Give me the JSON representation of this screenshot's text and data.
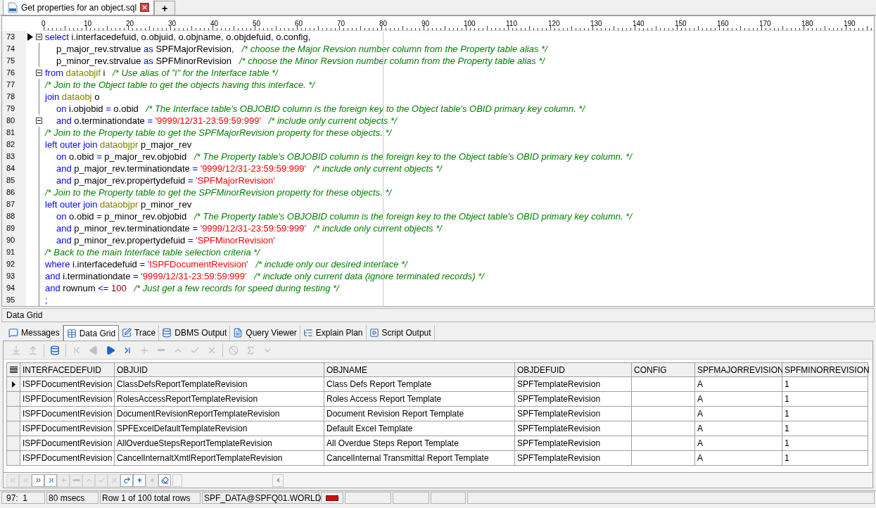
{
  "document_tabs": [
    {
      "label": "Get properties for an object.sql",
      "selected": true
    }
  ],
  "new_tab_button": "+",
  "editor": {
    "ruler": [
      "0",
      "10",
      "20",
      "30",
      "40",
      "50",
      "60",
      "70",
      "80",
      "90",
      "100",
      "110",
      "120",
      "130",
      "140",
      "150",
      "160",
      "170",
      "180",
      "190"
    ],
    "lines": [
      {
        "number": "73",
        "current": true,
        "fold": true,
        "indented": false,
        "tokens": [
          {
            "kind": "kw",
            "text": "select"
          },
          {
            "kind": "txt",
            "text": " i.interfacedefuid"
          },
          {
            "kind": "kw",
            "text": ","
          },
          {
            "kind": "txt",
            "text": " o.objuid"
          },
          {
            "kind": "kw",
            "text": ","
          },
          {
            "kind": "txt",
            "text": " o.objname"
          },
          {
            "kind": "kw",
            "text": ","
          },
          {
            "kind": "txt",
            "text": " o.objdefuid"
          },
          {
            "kind": "kw",
            "text": ","
          },
          {
            "kind": "txt",
            "text": " o.config"
          },
          {
            "kind": "kw",
            "text": ","
          }
        ]
      },
      {
        "number": "74",
        "current": false,
        "fold": false,
        "indented": true,
        "tokens": [
          {
            "kind": "txt",
            "text": "p_major_rev.strvalue "
          },
          {
            "kind": "kw",
            "text": "as"
          },
          {
            "kind": "txt",
            "text": " SPFMajorRevision"
          },
          {
            "kind": "kw",
            "text": ","
          },
          {
            "kind": "cmt",
            "text": "   /* choose the Major Revsion number column from the Property table alias */"
          }
        ]
      },
      {
        "number": "75",
        "current": false,
        "fold": false,
        "indented": true,
        "tokens": [
          {
            "kind": "txt",
            "text": "p_minor_rev.strvalue "
          },
          {
            "kind": "kw",
            "text": "as"
          },
          {
            "kind": "txt",
            "text": " SPFMinorRevision   "
          },
          {
            "kind": "cmt",
            "text": "/* choose the Minor Revsion number column from the Property table alias */"
          }
        ]
      },
      {
        "number": "76",
        "current": false,
        "fold": true,
        "indented": false,
        "tokens": [
          {
            "kind": "kw",
            "text": "from"
          },
          {
            "kind": "tbl",
            "text": " dataobjif"
          },
          {
            "kind": "txt",
            "text": " i   "
          },
          {
            "kind": "cmt",
            "text": "/* Use alias of \"i\" for the Interface table */"
          }
        ]
      },
      {
        "number": "77",
        "current": false,
        "fold": false,
        "indented": false,
        "tokens": [
          {
            "kind": "cmt",
            "text": "/* Join to the Object table to get the objects having this interface. */"
          }
        ]
      },
      {
        "number": "78",
        "current": false,
        "fold": false,
        "indented": false,
        "tokens": [
          {
            "kind": "kw",
            "text": "join"
          },
          {
            "kind": "tbl",
            "text": " dataobj"
          },
          {
            "kind": "txt",
            "text": " o"
          }
        ]
      },
      {
        "number": "79",
        "current": false,
        "fold": false,
        "indented": true,
        "tokens": [
          {
            "kind": "kw",
            "text": "on"
          },
          {
            "kind": "txt",
            "text": " i.objobid "
          },
          {
            "kind": "kw",
            "text": "="
          },
          {
            "kind": "txt",
            "text": " o.obid   "
          },
          {
            "kind": "cmt",
            "text": "/* The Interface table's OBJOBID column is the foreign key to the Object table's OBID primary key column. */"
          }
        ]
      },
      {
        "number": "80",
        "current": false,
        "fold": true,
        "indented": true,
        "tokens": [
          {
            "kind": "kw",
            "text": "and"
          },
          {
            "kind": "txt",
            "text": " o.terminationdate "
          },
          {
            "kind": "kw",
            "text": "="
          },
          {
            "kind": "str",
            "text": " '9999/12/31-23:59:59:999'"
          },
          {
            "kind": "cmt",
            "text": "   /* include only current objects */"
          }
        ]
      },
      {
        "number": "81",
        "current": false,
        "fold": false,
        "indented": false,
        "tokens": [
          {
            "kind": "cmt",
            "text": "/* Join to the Property table to get the SPFMajorRevision property for these objects. */"
          }
        ]
      },
      {
        "number": "82",
        "current": false,
        "fold": false,
        "indented": false,
        "tokens": [
          {
            "kind": "kw",
            "text": "left outer join"
          },
          {
            "kind": "tbl",
            "text": " dataobjpr"
          },
          {
            "kind": "txt",
            "text": " p_major_rev"
          }
        ]
      },
      {
        "number": "83",
        "current": false,
        "fold": false,
        "indented": true,
        "tokens": [
          {
            "kind": "kw",
            "text": "on"
          },
          {
            "kind": "txt",
            "text": " o.obid "
          },
          {
            "kind": "kw",
            "text": "="
          },
          {
            "kind": "txt",
            "text": " p_major_rev.objobid   "
          },
          {
            "kind": "cmt",
            "text": "/* The Property table's OBJOBID column is the foreign key to the Object table's OBID primary key column. */"
          }
        ]
      },
      {
        "number": "84",
        "current": false,
        "fold": false,
        "indented": true,
        "tokens": [
          {
            "kind": "kw",
            "text": "and"
          },
          {
            "kind": "txt",
            "text": " p_major_rev.terminationdate "
          },
          {
            "kind": "kw",
            "text": "="
          },
          {
            "kind": "str",
            "text": " '9999/12/31-23:59:59:999'"
          },
          {
            "kind": "cmt",
            "text": "   /* include only current objects */"
          }
        ]
      },
      {
        "number": "85",
        "current": false,
        "fold": false,
        "indented": true,
        "tokens": [
          {
            "kind": "kw",
            "text": "and"
          },
          {
            "kind": "txt",
            "text": " p_major_rev.propertydefuid "
          },
          {
            "kind": "kw",
            "text": "="
          },
          {
            "kind": "str",
            "text": " 'SPFMajorRevision'"
          }
        ]
      },
      {
        "number": "86",
        "current": false,
        "fold": false,
        "indented": false,
        "tokens": [
          {
            "kind": "cmt",
            "text": "/* Join to the Property table to get the SPFMinorRevision property for these objects. */"
          }
        ]
      },
      {
        "number": "87",
        "current": false,
        "fold": false,
        "indented": false,
        "tokens": [
          {
            "kind": "kw",
            "text": "left outer join"
          },
          {
            "kind": "tbl",
            "text": " dataobjpr"
          },
          {
            "kind": "txt",
            "text": " p_minor_rev"
          }
        ]
      },
      {
        "number": "88",
        "current": false,
        "fold": false,
        "indented": true,
        "tokens": [
          {
            "kind": "kw",
            "text": "on"
          },
          {
            "kind": "txt",
            "text": " o.obid "
          },
          {
            "kind": "kw",
            "text": "="
          },
          {
            "kind": "txt",
            "text": " p_minor_rev.objobid   "
          },
          {
            "kind": "cmt",
            "text": "/* The Property table's OBJOBID column is the foreign key to the Object table's OBID primary key column. */"
          }
        ]
      },
      {
        "number": "89",
        "current": false,
        "fold": false,
        "indented": true,
        "tokens": [
          {
            "kind": "kw",
            "text": "and"
          },
          {
            "kind": "txt",
            "text": " p_minor_rev.terminationdate "
          },
          {
            "kind": "kw",
            "text": "="
          },
          {
            "kind": "str",
            "text": " '9999/12/31-23:59:59:999'"
          },
          {
            "kind": "cmt",
            "text": "   /* include only current objects */"
          }
        ]
      },
      {
        "number": "90",
        "current": false,
        "fold": false,
        "indented": true,
        "tokens": [
          {
            "kind": "kw",
            "text": "and"
          },
          {
            "kind": "txt",
            "text": " p_minor_rev.propertydefuid "
          },
          {
            "kind": "kw",
            "text": "="
          },
          {
            "kind": "str",
            "text": " 'SPFMinorRevision'"
          }
        ]
      },
      {
        "number": "91",
        "current": false,
        "fold": false,
        "indented": false,
        "tokens": [
          {
            "kind": "cmt",
            "text": "/* Back to the main Interface table selection criteria */"
          }
        ]
      },
      {
        "number": "92",
        "current": false,
        "fold": false,
        "indented": false,
        "tokens": [
          {
            "kind": "kw",
            "text": "where"
          },
          {
            "kind": "txt",
            "text": " i.interfacedefuid "
          },
          {
            "kind": "kw",
            "text": "="
          },
          {
            "kind": "str",
            "text": " 'ISPFDocumentRevision'"
          },
          {
            "kind": "cmt",
            "text": "   /* include only our desired interface */"
          }
        ]
      },
      {
        "number": "93",
        "current": false,
        "fold": false,
        "indented": false,
        "tokens": [
          {
            "kind": "kw",
            "text": "and"
          },
          {
            "kind": "txt",
            "text": " i.terminationdate "
          },
          {
            "kind": "kw",
            "text": "="
          },
          {
            "kind": "str",
            "text": " '9999/12/31-23:59:59:999'"
          },
          {
            "kind": "cmt",
            "text": "   /* include only current data (ignore terminated records) */"
          }
        ]
      },
      {
        "number": "94",
        "current": false,
        "fold": false,
        "indented": false,
        "tokens": [
          {
            "kind": "kw",
            "text": "and"
          },
          {
            "kind": "txt",
            "text": " rownum "
          },
          {
            "kind": "kw",
            "text": "<="
          },
          {
            "kind": "num",
            "text": " 100"
          },
          {
            "kind": "cmt",
            "text": "   /* Just get a few records for speed during testing */"
          }
        ]
      },
      {
        "number": "95",
        "current": false,
        "fold": false,
        "indented": false,
        "tokens": [
          {
            "kind": "kw",
            "text": ";"
          }
        ]
      }
    ]
  },
  "panel_title": "Data Grid",
  "result_tabs": [
    {
      "label": "Messages",
      "selected": false
    },
    {
      "label": "Data Grid",
      "selected": true
    },
    {
      "label": "Trace",
      "selected": false
    },
    {
      "label": "DBMS Output",
      "selected": false
    },
    {
      "label": "Query Viewer",
      "selected": false
    },
    {
      "label": "Explain Plan",
      "selected": false
    },
    {
      "label": "Script Output",
      "selected": false
    }
  ],
  "toolbar": [
    {
      "kind": "import",
      "disabled": true
    },
    {
      "kind": "export",
      "disabled": true
    },
    {
      "kind": "dataset",
      "disabled": false
    },
    {
      "kind": "first",
      "disabled": true
    },
    {
      "kind": "prev",
      "disabled": true
    },
    {
      "kind": "next",
      "disabled": false
    },
    {
      "kind": "last",
      "disabled": false
    },
    {
      "kind": "insert",
      "disabled": true
    },
    {
      "kind": "delete",
      "disabled": true
    },
    {
      "kind": "up",
      "disabled": true
    },
    {
      "kind": "post",
      "disabled": true
    },
    {
      "kind": "cancel",
      "disabled": true
    },
    {
      "kind": "filter",
      "disabled": true
    },
    {
      "kind": "sum",
      "disabled": true
    },
    {
      "kind": "dropdown",
      "disabled": true
    }
  ],
  "grid": {
    "columns": [
      "INTERFACEDEFUID",
      "OBJUID",
      "OBJNAME",
      "OBJDEFUID",
      "CONFIG",
      "SPFMAJORREVISION",
      "SPFMINORREVISION"
    ],
    "rows": [
      {
        "selected": true,
        "cells": [
          "ISPFDocumentRevision",
          "ClassDefsReportTemplateRevision",
          "Class Defs Report Template",
          "SPFTemplateRevision",
          "",
          "A",
          "1"
        ]
      },
      {
        "selected": false,
        "cells": [
          "ISPFDocumentRevision",
          "RolesAccessReportTemplateRevision",
          "Roles Access Report Template",
          "SPFTemplateRevision",
          "",
          "A",
          "1"
        ]
      },
      {
        "selected": false,
        "cells": [
          "ISPFDocumentRevision",
          "DocumentRevisionReportTemplateRevision",
          "Document Revision Report Template",
          "SPFTemplateRevision",
          "",
          "A",
          "1"
        ]
      },
      {
        "selected": false,
        "cells": [
          "ISPFDocumentRevision",
          "SPFExcelDefaultTemplateRevision",
          "Default Excel Template",
          "SPFTemplateRevision",
          "",
          "A",
          "1"
        ]
      },
      {
        "selected": false,
        "cells": [
          "ISPFDocumentRevision",
          "AllOverdueStepsReportTemplateRevision",
          "All Overdue Steps Report Template",
          "SPFTemplateRevision",
          "",
          "A",
          "1"
        ]
      },
      {
        "selected": false,
        "cells": [
          "ISPFDocumentRevision",
          "CancelInternaltXmtlReportTemplateRevision",
          "CancelInternal Transmittal Report Template",
          "SPFTemplateRevision",
          "",
          "A",
          "1"
        ]
      }
    ]
  },
  "navigator": [
    {
      "kind": "first",
      "disabled": true
    },
    {
      "kind": "prior_page",
      "disabled": true
    },
    {
      "kind": "next_page",
      "disabled": false
    },
    {
      "kind": "last",
      "disabled": false
    },
    {
      "kind": "insert",
      "disabled": true
    },
    {
      "kind": "delete",
      "disabled": true
    },
    {
      "kind": "up",
      "disabled": true
    },
    {
      "kind": "post",
      "disabled": true
    },
    {
      "kind": "cancel",
      "disabled": true
    },
    {
      "kind": "refresh",
      "disabled": false
    },
    {
      "kind": "asterisk",
      "disabled": false
    },
    {
      "kind": "asterisk",
      "disabled": true
    },
    {
      "kind": "clear",
      "disabled": false
    }
  ],
  "status_bar": {
    "position": "97:  1",
    "time": "80 msecs",
    "rows": "Row 1 of 100 total rows",
    "connection": "SPF_DATA@SPFQ01.WORLD"
  }
}
